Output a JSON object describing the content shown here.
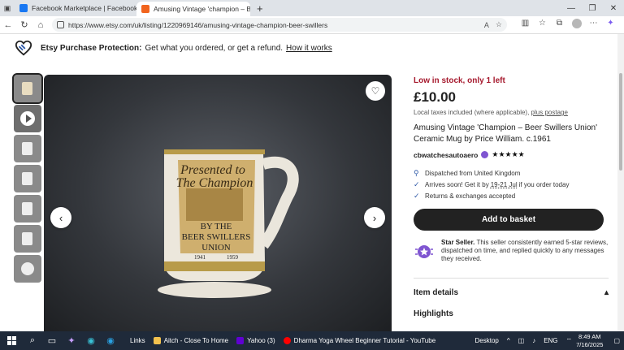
{
  "browser": {
    "tabs": [
      {
        "label": "Facebook Marketplace | Facebook",
        "favicon_color": "#1877f2"
      },
      {
        "label": "Amusing Vintage 'champion – Be",
        "favicon_color": "#f1641e"
      }
    ],
    "url": "https://www.etsy.com/uk/listing/1220969146/amusing-vintage-champion-beer-swillers"
  },
  "banner": {
    "title": "Etsy Purchase Protection:",
    "text": "Get what you ordered, or get a refund.",
    "link": "How it works"
  },
  "listing": {
    "stock": "Low in stock, only 1 left",
    "price": "£10.00",
    "tax_text": "Local taxes included (where applicable),",
    "tax_link": "plus postage",
    "title": "Amusing Vintage 'Champion – Beer Swillers Union' Ceramic Mug by Price William. c.1961",
    "seller": "cbwatchesautoaero",
    "stars": "★★★★★",
    "dispatch": "Dispatched from United Kingdom",
    "arrives_pre": "Arrives soon! Get it by",
    "arrives_date": "19-21 Jul",
    "arrives_post": "if you order today",
    "returns": "Returns & exchanges accepted",
    "add_to_basket": "Add to basket",
    "star_seller_title": "Star Seller.",
    "star_seller_text": "This seller consistently earned 5-star reviews, dispatched on time, and replied quickly to any messages they received.",
    "item_details": "Item details",
    "highlights": "Highlights"
  },
  "mug_text": {
    "line1": "Presented to",
    "line2": "The Champion",
    "line3": "BY THE",
    "line4": "BEER SWILLERS",
    "line5": "UNION",
    "year1": "1941",
    "year2": "1959"
  },
  "taskbar": {
    "links": "Links",
    "tasks": [
      {
        "label": "Aitch - Close To Home",
        "color": "#f2c14e"
      },
      {
        "label": "Yahoo (3)",
        "color": "#6001d2"
      },
      {
        "label": "Dharma Yoga Wheel Beginner Tutorial - YouTube",
        "color": "#ff0000"
      }
    ],
    "desktop": "Desktop",
    "lang": "ENG",
    "time": "8:49 AM",
    "date": "7/16/2025"
  }
}
